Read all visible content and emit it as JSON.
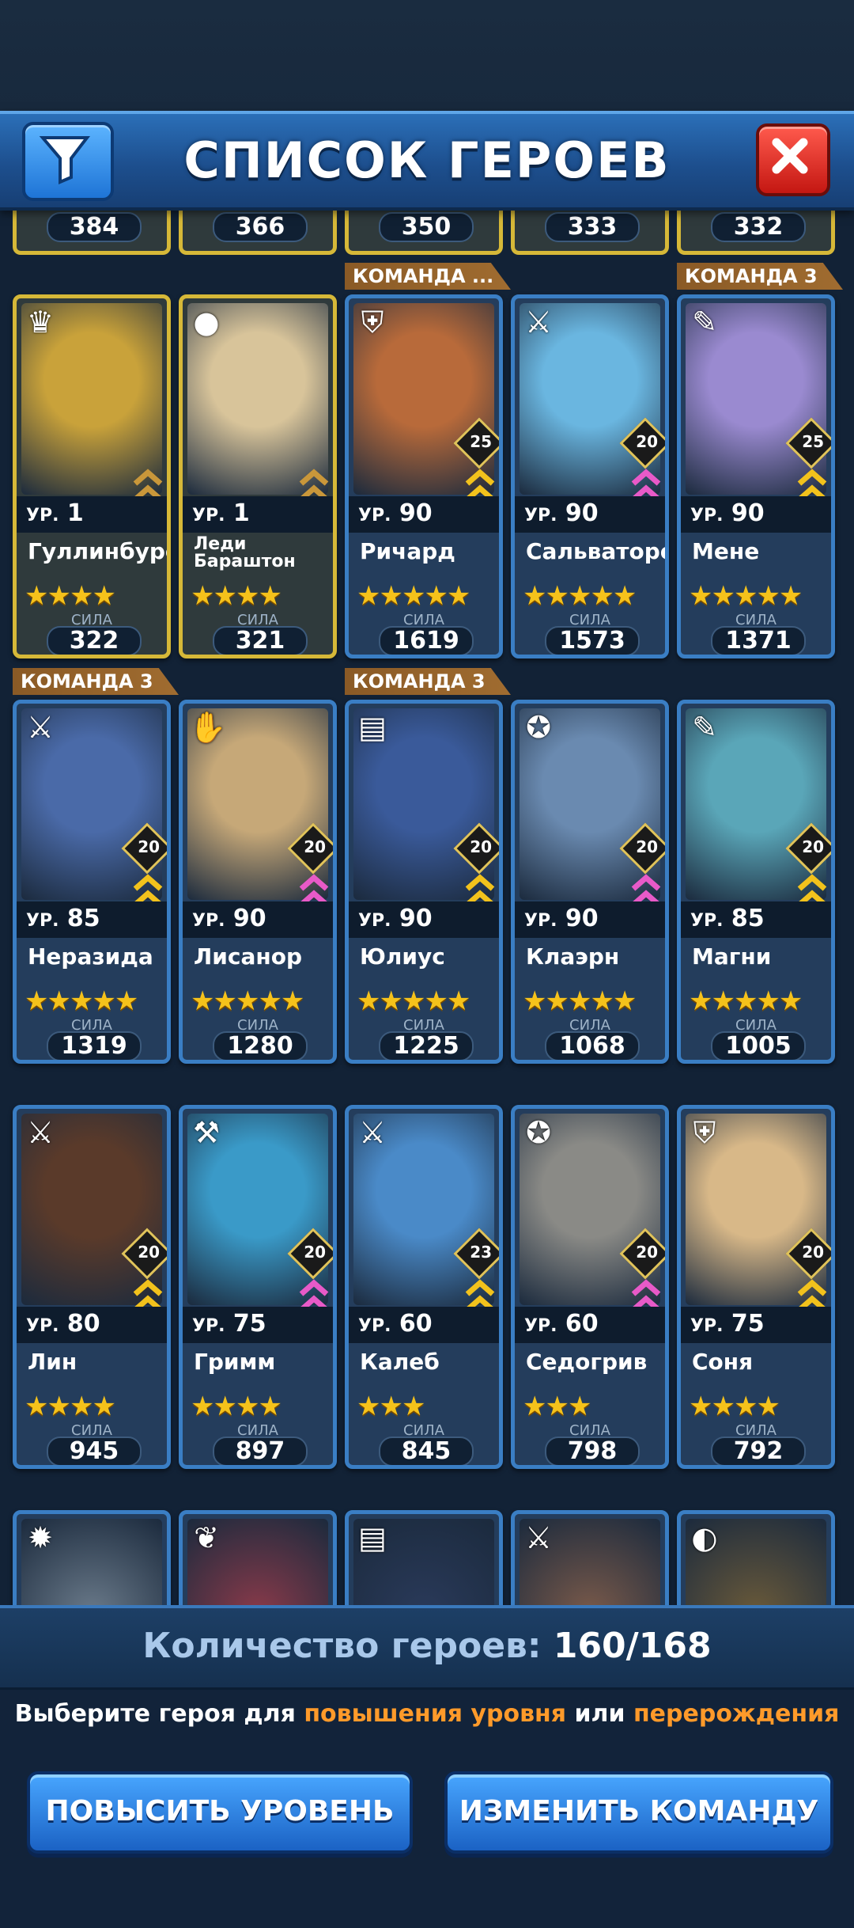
{
  "header": {
    "title": "СПИСОК ГЕРОЕВ"
  },
  "top_partial_powers": [
    "384",
    "366",
    "350",
    "333",
    "332"
  ],
  "rows": [
    {
      "tags": [
        {
          "text": "КОМАНДА ...",
          "col": 2
        },
        {
          "text": "КОМАНДА 3",
          "col": 4
        }
      ],
      "cards": [
        {
          "level": "1",
          "name": "Гуллинбурсти",
          "stars": "★★★★",
          "power": "322",
          "gold": true,
          "icon": "crown-icon",
          "glyph": "♛",
          "portrait": "#c9a23a"
        },
        {
          "level": "1",
          "name": "Леди Бараштон",
          "stars": "★★★★",
          "power": "321",
          "gold": true,
          "icon": "egg-icon",
          "glyph": "●",
          "portrait": "#d8c49a"
        },
        {
          "level": "90",
          "name": "Ричард",
          "stars": "★★★★★",
          "power": "1619",
          "badge": "25",
          "icon": "shield-icon",
          "glyph": "⛨",
          "portrait": "#b86a3a"
        },
        {
          "level": "90",
          "name": "Сальваторе",
          "stars": "★★★★★",
          "power": "1573",
          "badge": "20",
          "icon": "swords-icon",
          "glyph": "⚔",
          "portrait": "#6ab6e0"
        },
        {
          "level": "90",
          "name": "Мене",
          "stars": "★★★★★",
          "power": "1371",
          "badge": "25",
          "icon": "feather-icon",
          "glyph": "✎",
          "portrait": "#9a8ad0"
        }
      ]
    },
    {
      "tags": [
        {
          "text": "КОМАНДА 3",
          "col": 0
        },
        {
          "text": "КОМАНДА 3",
          "col": 2
        }
      ],
      "cards": [
        {
          "level": "85",
          "name": "Неразида",
          "stars": "★★★★★",
          "power": "1319",
          "badge": "20",
          "icon": "swords-icon",
          "glyph": "⚔",
          "portrait": "#4a6aa8"
        },
        {
          "level": "90",
          "name": "Лисанор",
          "stars": "★★★★★",
          "power": "1280",
          "badge": "20",
          "icon": "hand-icon",
          "glyph": "✋",
          "portrait": "#c6a878"
        },
        {
          "level": "90",
          "name": "Юлиус",
          "stars": "★★★★★",
          "power": "1225",
          "badge": "20",
          "icon": "book-icon",
          "glyph": "▤",
          "portrait": "#3a5a9a"
        },
        {
          "level": "90",
          "name": "Клаэрн",
          "stars": "★★★★★",
          "power": "1068",
          "badge": "20",
          "icon": "pentagram-icon",
          "glyph": "✪",
          "portrait": "#6a8ab0"
        },
        {
          "level": "85",
          "name": "Магни",
          "stars": "★★★★★",
          "power": "1005",
          "badge": "20",
          "icon": "feather-icon",
          "glyph": "✎",
          "portrait": "#5aa6b8"
        }
      ]
    },
    {
      "tags": [],
      "cards": [
        {
          "level": "80",
          "name": "Лин",
          "stars": "★★★★",
          "power": "945",
          "badge": "20",
          "icon": "swords-icon",
          "glyph": "⚔",
          "portrait": "#5a3a2a"
        },
        {
          "level": "75",
          "name": "Гримм",
          "stars": "★★★★",
          "power": "897",
          "badge": "20",
          "icon": "axe-icon",
          "glyph": "⚒",
          "portrait": "#3a9ac8"
        },
        {
          "level": "60",
          "name": "Калеб",
          "stars": "★★★",
          "power": "845",
          "badge": "23",
          "icon": "swords-icon",
          "glyph": "⚔",
          "portrait": "#4a8ac8"
        },
        {
          "level": "60",
          "name": "Седогрив",
          "stars": "★★★",
          "power": "798",
          "badge": "20",
          "icon": "pentagram-icon",
          "glyph": "✪",
          "portrait": "#8a8a86"
        },
        {
          "level": "75",
          "name": "Соня",
          "stars": "★★★★",
          "power": "792",
          "badge": "20",
          "icon": "shield-icon",
          "glyph": "⛨",
          "portrait": "#d8b888"
        }
      ]
    }
  ],
  "partial_bottom_icons": [
    {
      "icon": "sun-icon",
      "glyph": "✹",
      "portrait": "#6a7a8a"
    },
    {
      "icon": "leaf-icon",
      "glyph": "❦",
      "portrait": "#8a3a4a"
    },
    {
      "icon": "book-icon",
      "glyph": "▤",
      "portrait": "#2a3a5a"
    },
    {
      "icon": "swords-icon",
      "glyph": "⚔",
      "portrait": "#7a5a4a"
    },
    {
      "icon": "mask-icon",
      "glyph": "◐",
      "portrait": "#6a5a3a"
    }
  ],
  "labels": {
    "level_prefix": "УР.",
    "power_label": "СИЛА"
  },
  "footer": {
    "count_label": "Количество героев:",
    "count_value": "160/168",
    "hint_a": "Выберите героя для ",
    "hint_b": "повышения уровня",
    "hint_c": " или ",
    "hint_d": "перерождения",
    "btn_level": "ПОВЫСИТЬ УРОВЕНЬ",
    "btn_team": "ИЗМЕНИТЬ КОМАНДУ"
  },
  "colors": {
    "accent_orange": "#ff9a2a",
    "gold_border": "#d6b838",
    "blue_border": "#3a7ec4"
  }
}
